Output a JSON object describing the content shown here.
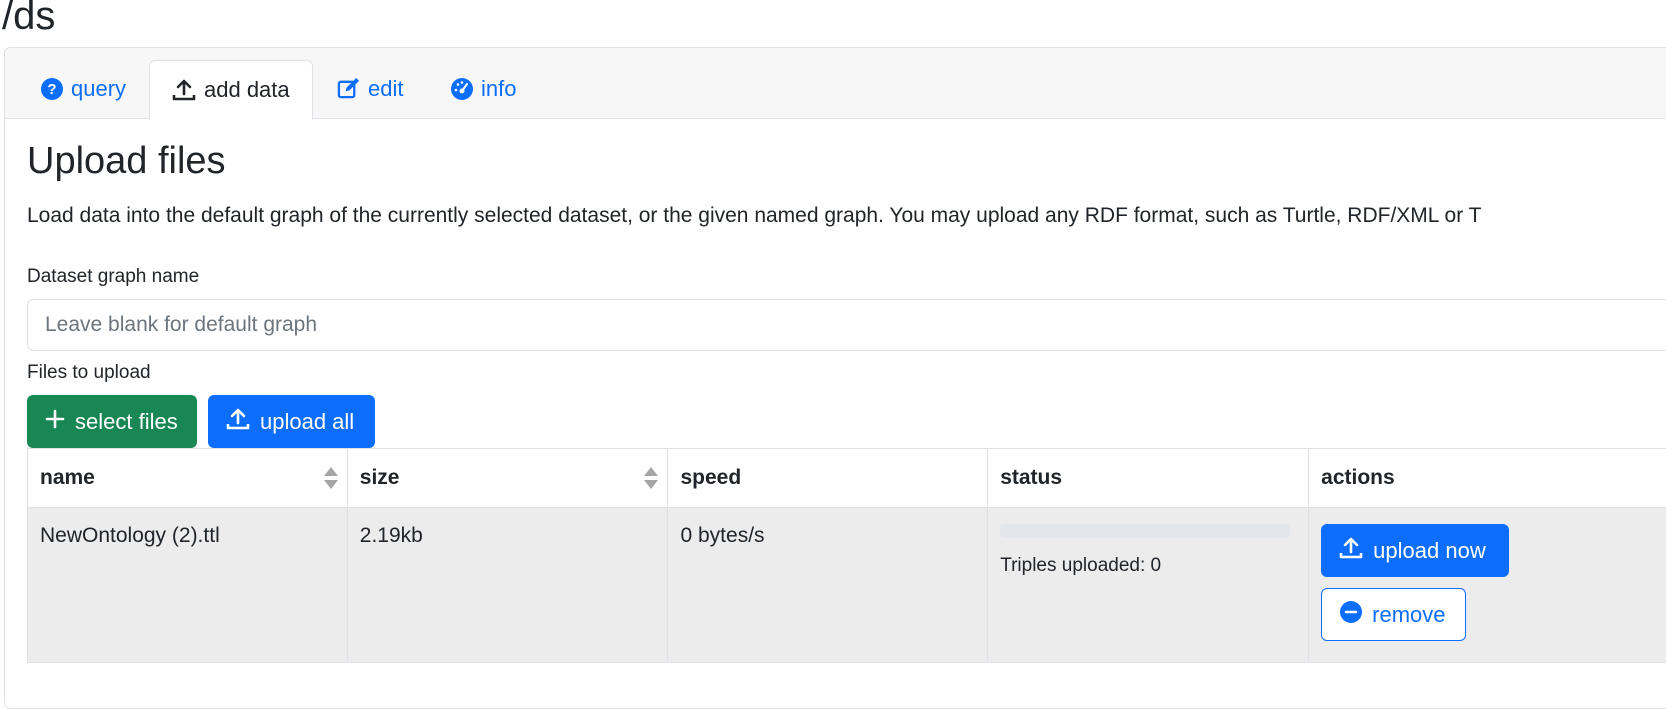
{
  "page": {
    "title": "/ds"
  },
  "tabs": [
    {
      "label": "query",
      "icon": "question-circle-icon"
    },
    {
      "label": "add data",
      "icon": "upload-icon",
      "active": true
    },
    {
      "label": "edit",
      "icon": "edit-icon"
    },
    {
      "label": "info",
      "icon": "dashboard-icon"
    }
  ],
  "upload": {
    "heading": "Upload files",
    "description": "Load data into the default graph of the currently selected dataset, or the given named graph. You may upload any RDF format, such as Turtle, RDF/XML or T",
    "graph_label": "Dataset graph name",
    "graph_placeholder": "Leave blank for default graph",
    "graph_value": "",
    "files_label": "Files to upload",
    "select_files_label": "select files",
    "upload_all_label": "upload all"
  },
  "table": {
    "columns": [
      "name",
      "size",
      "speed",
      "status",
      "actions"
    ],
    "rows": [
      {
        "name": "NewOntology (2).ttl",
        "size": "2.19kb",
        "speed": "0 bytes/s",
        "progress": 0,
        "status_text": "Triples uploaded: 0",
        "upload_now_label": "upload now",
        "remove_label": "remove"
      }
    ]
  },
  "colors": {
    "primary": "#0d6efd",
    "success": "#198754",
    "text": "#212529",
    "row_bg": "#ececec"
  }
}
